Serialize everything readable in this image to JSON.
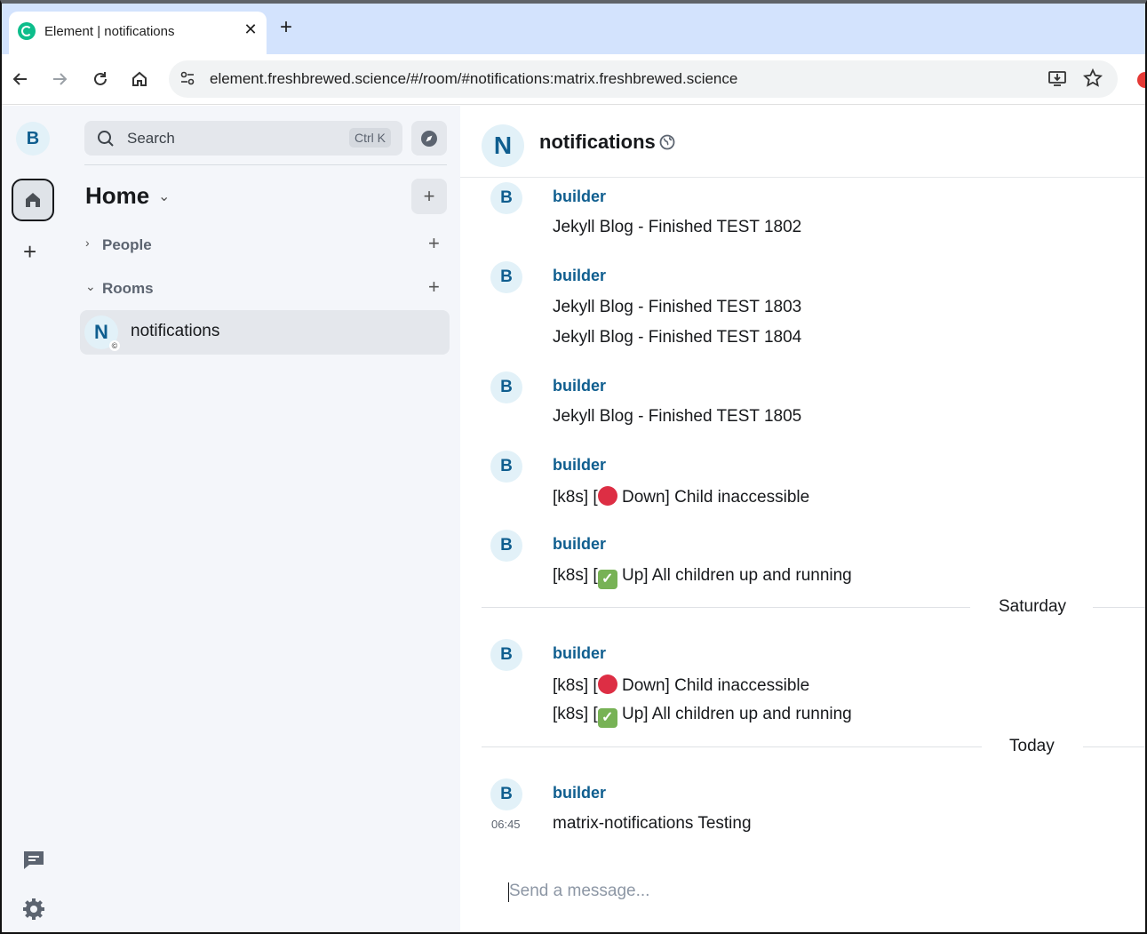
{
  "browser": {
    "tab_title": "Element | notifications",
    "tab_close": "✕",
    "new_tab": "+",
    "url": "element.freshbrewed.science/#/room/#notifications:matrix.freshbrewed.science",
    "icons": [
      "back-icon",
      "forward-icon",
      "reload-icon",
      "home-icon",
      "site-settings-icon",
      "install-icon",
      "star-icon",
      "extension-icon"
    ]
  },
  "spaces": {
    "user_initial": "B",
    "add": "+"
  },
  "roomlist": {
    "search_label": "Search",
    "search_shortcut": "Ctrl K",
    "home_title": "Home",
    "home_chevron": "⌄",
    "add": "+",
    "sections": [
      {
        "label": "People",
        "chevron": "›",
        "add": "+"
      },
      {
        "label": "Rooms",
        "chevron": "⌄",
        "add": "+"
      }
    ],
    "rooms": [
      {
        "initial": "N",
        "name": "notifications",
        "badge": "©"
      }
    ]
  },
  "room": {
    "initial": "N",
    "name": "notifications"
  },
  "timeline": {
    "groups": [
      {
        "avatar": "B",
        "sender": "builder",
        "lines": [
          "Jekyll Blog - Finished TEST 1802"
        ]
      },
      {
        "avatar": "B",
        "sender": "builder",
        "lines": [
          "Jekyll Blog - Finished TEST 1803",
          "Jekyll Blog - Finished TEST 1804"
        ]
      },
      {
        "avatar": "B",
        "sender": "builder",
        "lines": [
          "Jekyll Blog - Finished TEST 1805"
        ]
      },
      {
        "avatar": "B",
        "sender": "builder",
        "lines": [
          {
            "pre": "[k8s] [",
            "emoji": "red-circle",
            "post": " Down] Child inaccessible"
          }
        ]
      },
      {
        "avatar": "B",
        "sender": "builder",
        "lines": [
          {
            "pre": "[k8s] [",
            "emoji": "check-mark",
            "post": " Up] All children up and running"
          }
        ]
      },
      {
        "avatar": "B",
        "sender": "builder",
        "lines": [
          {
            "pre": "[k8s] [",
            "emoji": "red-circle",
            "post": " Down] Child inaccessible"
          },
          {
            "pre": "[k8s] [",
            "emoji": "check-mark",
            "post": " Up] All children up and running"
          }
        ]
      },
      {
        "avatar": "B",
        "sender": "builder",
        "timestamp": "06:45",
        "lines": [
          "matrix-notifications Testing"
        ]
      }
    ],
    "date_separators": [
      "Saturday",
      "Today"
    ],
    "check_glyph": "✓"
  },
  "composer": {
    "placeholder": "Send a message..."
  },
  "colors": {
    "accent": "#0f5e8f",
    "avatar_bg": "#e2f1f8",
    "sidebar_bg": "#f4f6fa",
    "tab_strip": "#d3e3fd"
  }
}
